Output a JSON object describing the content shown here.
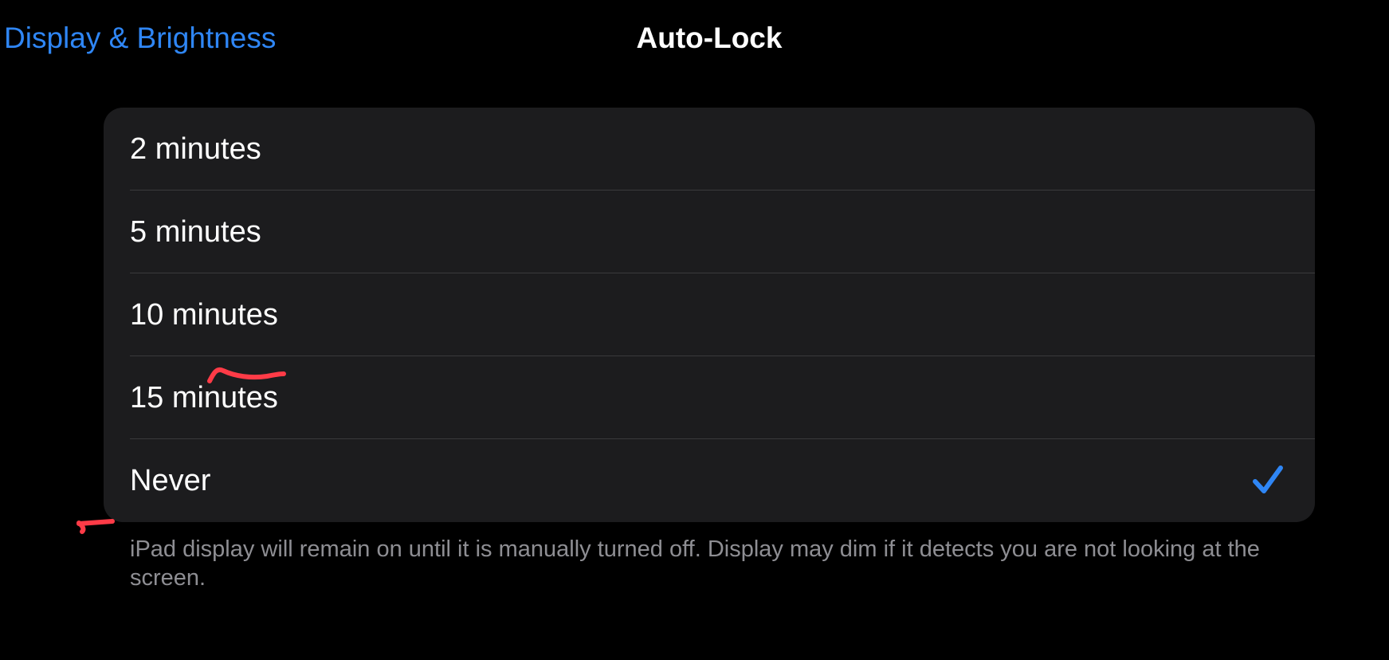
{
  "nav": {
    "back_label": "Display & Brightness",
    "title": "Auto-Lock"
  },
  "options": [
    {
      "label": "2 minutes",
      "selected": false
    },
    {
      "label": "5 minutes",
      "selected": false
    },
    {
      "label": "10 minutes",
      "selected": false
    },
    {
      "label": "15 minutes",
      "selected": false
    },
    {
      "label": "Never",
      "selected": true
    }
  ],
  "footer": {
    "note": "iPad display will remain on until it is manually turned off. Display may dim if it detects you are not looking at the screen."
  },
  "icons": {
    "selected_check": "checkmark-icon"
  },
  "colors": {
    "accent": "#2f86f5",
    "background": "#000000",
    "group_background": "#1c1c1e",
    "secondary_text": "#8e8e93",
    "annotation": "#ff3b47"
  }
}
